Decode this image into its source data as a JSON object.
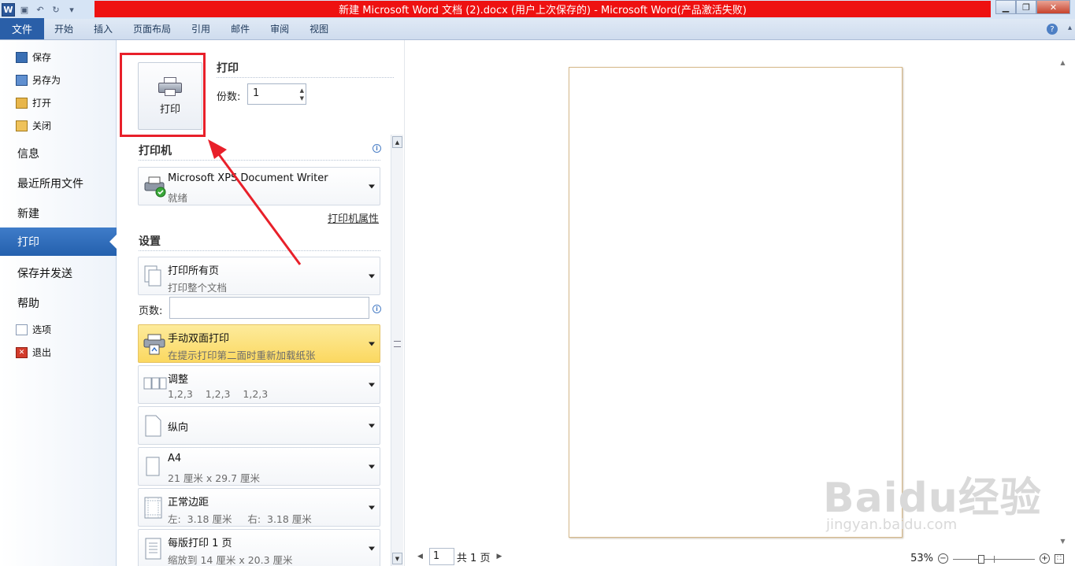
{
  "window": {
    "title": "新建 Microsoft Word 文档 (2).docx (用户上次保存的)  -  Microsoft Word(产品激活失败)",
    "min_label": "▁",
    "max_label": "❐",
    "close_label": "✕",
    "app_logo": "W"
  },
  "ribbon": {
    "file_tab": "文件",
    "tabs": [
      "开始",
      "插入",
      "页面布局",
      "引用",
      "邮件",
      "审阅",
      "视图"
    ],
    "help": "?"
  },
  "backstage_nav": {
    "save": "保存",
    "save_as": "另存为",
    "open": "打开",
    "close": "关闭",
    "info": "信息",
    "recent": "最近所用文件",
    "new": "新建",
    "print": "打印",
    "save_send": "保存并发送",
    "help": "帮助",
    "options": "选项",
    "exit": "退出"
  },
  "print_section": {
    "button_label": "打印",
    "title": "打印",
    "copies_label": "份数:",
    "copies_value": "1"
  },
  "printer_section": {
    "title": "打印机",
    "printer_name": "Microsoft XPS Document Writer",
    "printer_status": "就绪",
    "properties_link": "打印机属性"
  },
  "settings_section": {
    "title": "设置",
    "pages_label": "页数:",
    "options": [
      {
        "title": "打印所有页",
        "subtitle": "打印整个文档"
      },
      {
        "title": "手动双面打印",
        "subtitle": "在提示打印第二面时重新加载纸张"
      },
      {
        "title": "调整",
        "subtitle": "1,2,3    1,2,3    1,2,3"
      },
      {
        "title": "纵向",
        "subtitle": ""
      },
      {
        "title": "A4",
        "subtitle": "21 厘米 x 29.7 厘米"
      },
      {
        "title": "正常边距",
        "subtitle": "左:  3.18 厘米     右:  3.18 厘米"
      },
      {
        "title": "每版打印 1 页",
        "subtitle": "缩放到 14 厘米 x 20.3 厘米"
      }
    ]
  },
  "preview": {
    "current_page": "1",
    "total_pages_label": "共 1 页",
    "zoom_level": "53%",
    "zoom_fraction": 0.33
  },
  "watermark": {
    "brand": "Baidu经验",
    "url": "jingyan.baidu.com"
  },
  "colors": {
    "title_bar_highlight": "#ee1111",
    "file_tab": "#2a5fa8",
    "active_nav": "#2460ad",
    "annotation_red": "#e8202a",
    "duplex_highlight": "#fbd860"
  }
}
